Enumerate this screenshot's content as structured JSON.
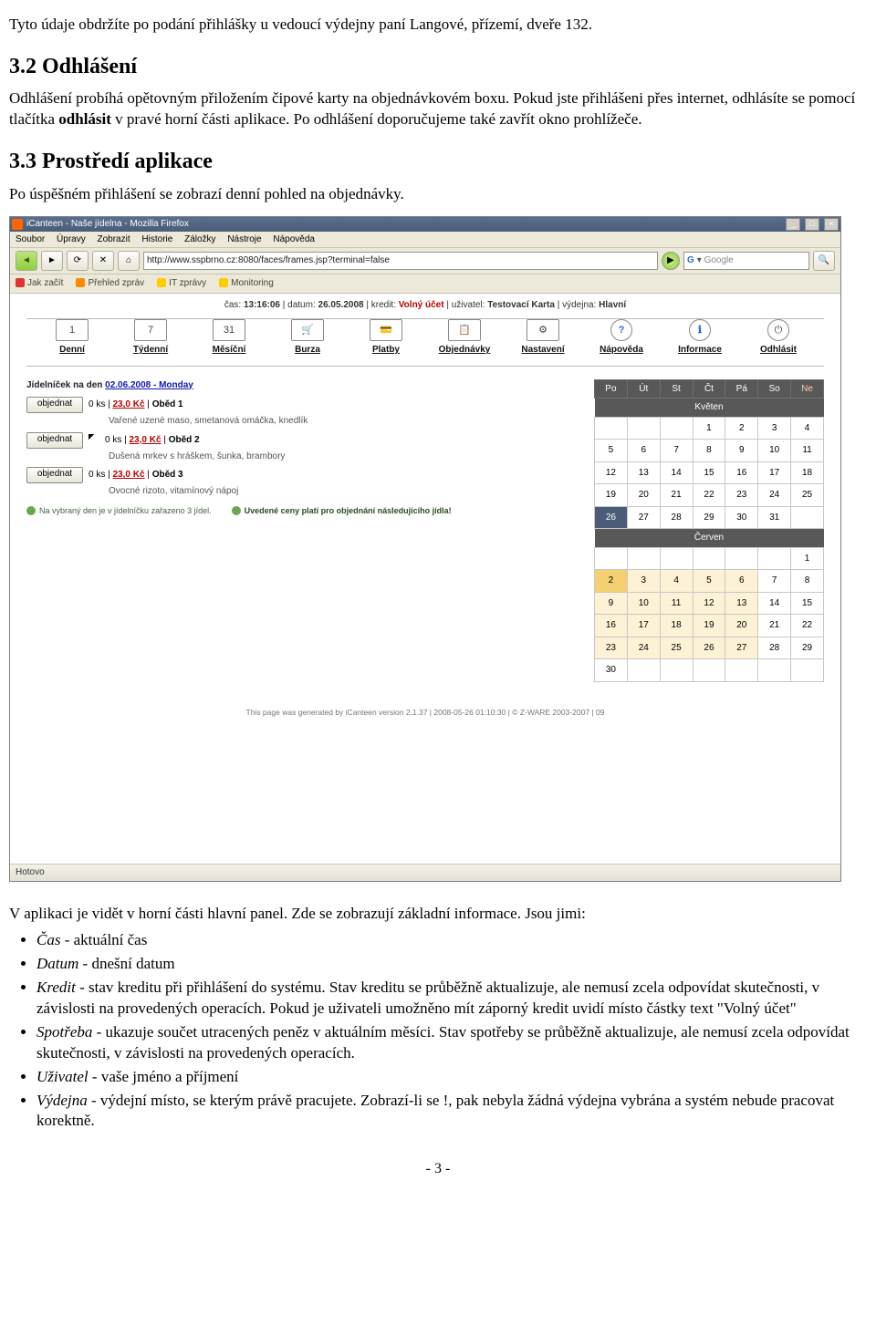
{
  "doc": {
    "p1": "Tyto údaje obdržíte po podání přihlášky u vedoucí výdejny paní Langové, přízemí, dveře  132.",
    "h1": "3.2 Odhlášení",
    "p2a": "Odhlášení probíhá opětovným přiložením čipové karty na objednávkovém boxu. Pokud jste přihlášeni přes internet, odhlásíte se pomocí tlačítka ",
    "p2b": "odhlásit",
    "p2c": " v pravé horní části aplikace. Po odhlášení doporučujeme také zavřít okno prohlížeče.",
    "h2": "3.3 Prostředí aplikace",
    "p3": "Po úspěšném přihlášení se zobrazí denní pohled na objednávky.",
    "p4": "V aplikaci je vidět v horní části hlavní panel. Zde se zobrazují základní informace. Jsou jimi:",
    "bullets": [
      {
        "i": "Čas",
        "t": " - aktuální čas"
      },
      {
        "i": "Datum",
        "t": " - dnešní datum"
      },
      {
        "i": "Kredit",
        "t": " - stav kreditu při přihlášení do systému. Stav kreditu se průběžně aktualizuje, ale nemusí zcela odpovídat skutečnosti, v závislosti na provedených operacích. Pokud je uživateli umožněno mít záporný kredit uvidí místo částky text \"Volný účet\""
      },
      {
        "i": "Spotřeba",
        "t": " - ukazuje součet utracených peněz v aktuálním měsíci. Stav spotřeby se průběžně aktualizuje, ale nemusí zcela odpovídat skutečnosti, v závislosti na provedených operacích."
      },
      {
        "i": "Uživatel",
        "t": " - vaše jméno a příjmení"
      },
      {
        "i": "Výdejna",
        "t": " - výdejní místo, se kterým právě pracujete. Zobrazí-li se !, pak nebyla žádná výdejna vybrána a systém nebude pracovat korektně."
      }
    ],
    "pagenum": "- 3 -"
  },
  "browser": {
    "title": "iCanteen - Naše jídelna - Mozilla Firefox",
    "menu": [
      "Soubor",
      "Úpravy",
      "Zobrazit",
      "Historie",
      "Záložky",
      "Nástroje",
      "Nápověda"
    ],
    "url": "http://www.sspbrno.cz:8080/faces/frames.jsp?terminal=false",
    "search": "Google",
    "bookmarks": [
      "Jak začít",
      "Přehled zpráv",
      "IT zprávy",
      "Monitoring"
    ],
    "status": "Hotovo"
  },
  "app": {
    "statusline": {
      "cas_l": "čas:",
      "cas": "13:16:06",
      "dat_l": "datum:",
      "dat": "26.05.2008",
      "kr_l": "kredit:",
      "kr": "Volný účet",
      "uz_l": "uživatel:",
      "uz": "Testovací Karta",
      "vy_l": "výdejna:",
      "vy": "Hlavní"
    },
    "nav": [
      {
        "k": "denni",
        "l": "Denní",
        "g": "1"
      },
      {
        "k": "tydenni",
        "l": "Týdenní",
        "g": "7"
      },
      {
        "k": "mesicni",
        "l": "Měsíční",
        "g": "31"
      },
      {
        "k": "burza",
        "l": "Burza",
        "g": "🛒"
      },
      {
        "k": "platby",
        "l": "Platby",
        "g": "💳"
      },
      {
        "k": "objednavky",
        "l": "Objednávky",
        "g": "📋"
      },
      {
        "k": "nastaveni",
        "l": "Nastavení",
        "g": "⚙"
      },
      {
        "k": "napoveda",
        "l": "Nápověda",
        "g": "?"
      },
      {
        "k": "informace",
        "l": "Informace",
        "g": "ℹ"
      },
      {
        "k": "odhlasit",
        "l": "Odhlásit",
        "g": "⏻"
      }
    ],
    "menu_title_pre": "Jídelníček na den ",
    "menu_title_date": "02.06.2008 - Monday",
    "order_btn": "objednat",
    "meals": [
      {
        "ks": "0 ks",
        "price": "23,0 Kč",
        "name": "Oběd 1",
        "desc": "Vařené uzené maso, smetanová omáčka, knedlík"
      },
      {
        "ks": "0 ks",
        "price": "23,0 Kč",
        "name": "Oběd 2",
        "desc": "Dušená mrkev s hráškem, šunka, brambory"
      },
      {
        "ks": "0 ks",
        "price": "23,0 Kč",
        "name": "Oběd 3",
        "desc": "Ovocné rizoto, vitamínový nápoj"
      }
    ],
    "note1": "Na vybraný den je v jídelníčku zařazeno 3 jídel.",
    "note2": "Uvedené ceny platí pro objednání následujícího jídla!",
    "cal": {
      "dow": [
        "Po",
        "Út",
        "St",
        "Čt",
        "Pá",
        "So",
        "Ne"
      ],
      "m1": "Květen",
      "m2": "Červen"
    },
    "gen": "This page was generated by iCanteen version 2.1.37 | 2008-05-26 01:10:30 | © Z-WARE 2003-2007 | 09"
  }
}
